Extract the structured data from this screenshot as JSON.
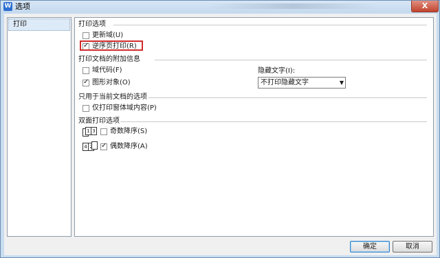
{
  "window": {
    "title": "选项",
    "app_icon": "W",
    "close_label": "X"
  },
  "sidebar": {
    "items": [
      {
        "label": "打印",
        "selected": true
      }
    ]
  },
  "panel": {
    "print_options": {
      "title": "打印选项",
      "items": [
        {
          "label": "更新域(U)",
          "checked": false
        },
        {
          "label": "逆序页打印(R)",
          "checked": true,
          "highlighted": true
        }
      ]
    },
    "attached_info": {
      "title": "打印文档的附加信息",
      "items": [
        {
          "label": "域代码(F)",
          "checked": false
        },
        {
          "label": "图形对象(O)",
          "checked": true
        }
      ],
      "hidden_text_label": "隐藏文字(I):",
      "hidden_text_value": "不打印隐藏文字"
    },
    "current_doc": {
      "title": "只用于当前文档的选项",
      "items": [
        {
          "label": "仅打印窗体域内容(P)",
          "checked": false
        }
      ]
    },
    "duplex": {
      "title": "双面打印选项",
      "items": [
        {
          "label": "奇数降序(S)",
          "checked": false,
          "icon": "odd-pages-icon",
          "pages": [
            "1",
            "3"
          ]
        },
        {
          "label": "偶数降序(A)",
          "checked": true,
          "icon": "even-pages-icon",
          "pages": [
            "4",
            "2"
          ]
        }
      ]
    }
  },
  "buttons": {
    "ok": "确定",
    "cancel": "取消"
  },
  "colors": {
    "highlight_border": "#d12b2b",
    "title_bar": "#c4d9ee",
    "close_button": "#c1442e"
  }
}
